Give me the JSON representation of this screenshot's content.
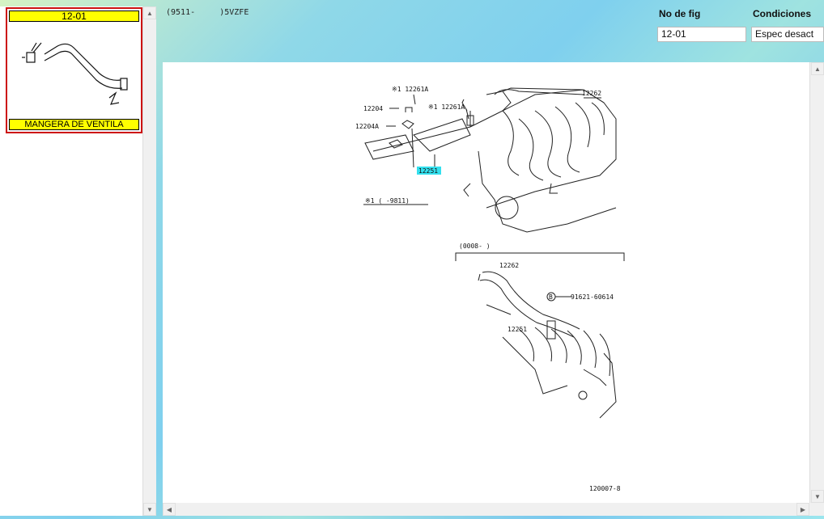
{
  "thumbnail": {
    "figure_no": "12-01",
    "caption": "MANGERA DE VENTILA"
  },
  "header": {
    "model_range": "(9511-     )5VZFE",
    "fig_no_label": "No de fig",
    "conditions_label": "Condiciones",
    "fig_no_value": "12-01",
    "conditions_value": "Espec desact"
  },
  "diagram": {
    "labels": {
      "note_12261a_top": "※1 12261A",
      "note_12261a_mid": "※1 12261A",
      "p12204": "12204",
      "p12204a": "12204A",
      "p12262_top": "12262",
      "p12251_highlight": "12251",
      "footnote": "※1 (      -9811)",
      "variant_range": "(0008-      )",
      "p12262_bottom": "12262",
      "p91621": "91621-60614",
      "p12251_bottom": "12251",
      "circle_b": "B",
      "drawing_id": "120007-8"
    },
    "highlight_color": "#33e0ee"
  },
  "icons": {
    "scroll_up": "scroll-up-arrow-icon",
    "scroll_down": "scroll-down-arrow-icon",
    "scroll_left": "scroll-left-arrow-icon",
    "scroll_right": "scroll-right-arrow-icon"
  }
}
